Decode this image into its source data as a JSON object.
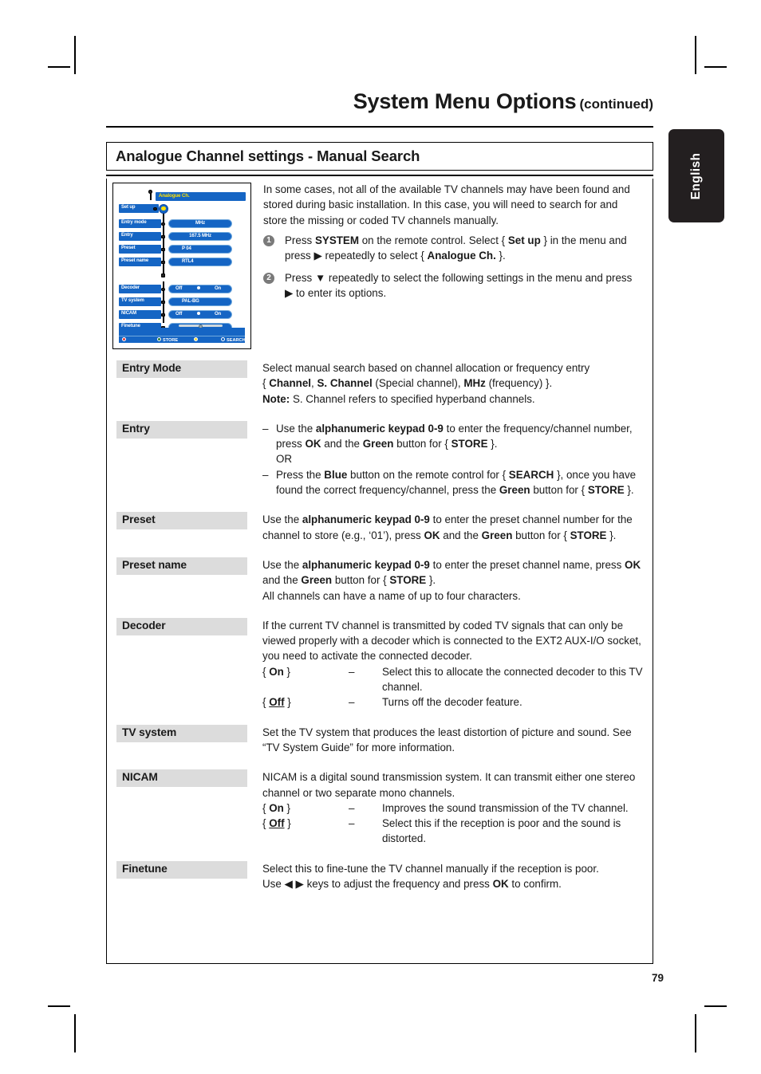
{
  "page": {
    "title": "System Menu Options",
    "title_suffix": "(continued)",
    "section_heading": "Analogue Channel settings - Manual Search",
    "language_tab": "English",
    "page_number": "79"
  },
  "intro": {
    "paragraph": "In some cases, not all of the available TV channels may have been found and stored during basic installation. In this case, you will need to search for and store the missing or coded TV channels manually."
  },
  "steps": [
    {
      "num": "1",
      "parts": [
        {
          "t": "Press ",
          "b": false
        },
        {
          "t": "SYSTEM",
          "b": true
        },
        {
          "t": " on the remote control. Select { ",
          "b": false
        },
        {
          "t": "Set up",
          "b": true
        },
        {
          "t": " } in the menu and press ▶ repeatedly to select { ",
          "b": false
        },
        {
          "t": "Analogue Ch.",
          "b": true
        },
        {
          "t": " }.",
          "b": false
        }
      ]
    },
    {
      "num": "2",
      "parts": [
        {
          "t": "Press ▼ repeatedly to select the following settings in the menu and press ▶ to enter its options.",
          "b": false
        }
      ]
    }
  ],
  "tv_screen": {
    "title": "Analogue Ch.",
    "setup_label": "Set up",
    "group1": [
      {
        "label": "Entry mode",
        "value": "MHz"
      },
      {
        "label": "Entry",
        "value": "167.5 MHz"
      },
      {
        "label": "Preset",
        "value": "P 04"
      },
      {
        "label": "Preset name",
        "value": "RTL4"
      }
    ],
    "group2": [
      {
        "label": "Decoder",
        "value_off": "Off",
        "value_on": "On",
        "selected": "On"
      },
      {
        "label": "TV system",
        "value": "PAL-BG"
      },
      {
        "label": "NICAM",
        "value_off": "Off",
        "value_on": "On",
        "selected": "On"
      },
      {
        "label": "Finetune",
        "value": ""
      }
    ],
    "footer": [
      {
        "dot_color": "#e53935",
        "label": ""
      },
      {
        "dot_color": "#2e7d32",
        "label": "STORE"
      },
      {
        "dot_color": "#fdd835",
        "label": ""
      },
      {
        "dot_color": "#1565c4",
        "label": "SEARCH"
      }
    ],
    "colors": {
      "osd_blue": "#1565c4",
      "osd_title_text": "#ffe000",
      "highlight": "#ffe000"
    }
  },
  "definitions": [
    {
      "term": "Entry Mode",
      "lines": [
        [
          {
            "t": "Select manual search based on channel allocation or frequency entry",
            "b": false
          }
        ],
        [
          {
            "t": "{ ",
            "b": false
          },
          {
            "t": "Channel",
            "b": true
          },
          {
            "t": ", ",
            "b": false
          },
          {
            "t": "S. Channel",
            "b": true
          },
          {
            "t": " (Special channel), ",
            "b": false
          },
          {
            "t": "MHz",
            "b": true
          },
          {
            "t": " (frequency) }.",
            "b": false
          }
        ],
        [
          {
            "t": "Note:",
            "b": true
          },
          {
            "t": " S. Channel refers to specified hyperband channels.",
            "b": false
          }
        ]
      ]
    },
    {
      "term": "Entry",
      "bullets": [
        {
          "mark": "–",
          "parts": [
            {
              "t": "Use the ",
              "b": false
            },
            {
              "t": "alphanumeric keypad 0-9",
              "b": true
            },
            {
              "t": " to enter the frequency/channel number, press ",
              "b": false
            },
            {
              "t": "OK",
              "b": true
            },
            {
              "t": " and the ",
              "b": false
            },
            {
              "t": "Green",
              "b": true
            },
            {
              "t": " button for { ",
              "b": false
            },
            {
              "t": "STORE",
              "b": true
            },
            {
              "t": " }.",
              "b": false
            }
          ]
        },
        {
          "mark": "",
          "parts": [
            {
              "t": "OR",
              "b": false
            }
          ]
        },
        {
          "mark": "–",
          "parts": [
            {
              "t": "Press the ",
              "b": false
            },
            {
              "t": "Blue",
              "b": true
            },
            {
              "t": " button on the remote control for { ",
              "b": false
            },
            {
              "t": "SEARCH",
              "b": true
            },
            {
              "t": " }, once you have found the correct frequency/channel, press the ",
              "b": false
            },
            {
              "t": "Green",
              "b": true
            },
            {
              "t": " button for { ",
              "b": false
            },
            {
              "t": "STORE",
              "b": true
            },
            {
              "t": " }.",
              "b": false
            }
          ]
        }
      ]
    },
    {
      "term": "Preset",
      "lines": [
        [
          {
            "t": "Use the ",
            "b": false
          },
          {
            "t": "alphanumeric keypad 0-9",
            "b": true
          },
          {
            "t": " to enter the preset channel number for the channel to store (e.g., ‘01’), press ",
            "b": false
          },
          {
            "t": "OK",
            "b": true
          },
          {
            "t": " and the ",
            "b": false
          },
          {
            "t": "Green",
            "b": true
          },
          {
            "t": " button for { ",
            "b": false
          },
          {
            "t": "STORE",
            "b": true
          },
          {
            "t": " }.",
            "b": false
          }
        ]
      ]
    },
    {
      "term": "Preset name",
      "lines": [
        [
          {
            "t": "Use the ",
            "b": false
          },
          {
            "t": "alphanumeric keypad 0-9",
            "b": true
          },
          {
            "t": " to enter the preset channel name, press ",
            "b": false
          },
          {
            "t": "OK",
            "b": true
          },
          {
            "t": " and the ",
            "b": false
          },
          {
            "t": "Green",
            "b": true
          },
          {
            "t": " button for { ",
            "b": false
          },
          {
            "t": "STORE",
            "b": true
          },
          {
            "t": " }.",
            "b": false
          }
        ],
        [
          {
            "t": "All channels can have a name of up to four characters.",
            "b": false
          }
        ]
      ]
    },
    {
      "term": "Decoder",
      "lines": [
        [
          {
            "t": "If the current TV channel is transmitted by coded TV signals that can only be viewed properly with a decoder which is connected to the EXT2 AUX-I/O socket, you need to activate the connected decoder.",
            "b": false
          }
        ]
      ],
      "options": [
        {
          "opt": "{ On }",
          "opt_bold": "On",
          "dash": "–",
          "text": "Select this to allocate the connected decoder to this TV channel."
        },
        {
          "opt": "{ Off }",
          "opt_bold": "Off",
          "underline": true,
          "dash": "–",
          "text": "Turns off the decoder feature."
        }
      ]
    },
    {
      "term": "TV system",
      "lines": [
        [
          {
            "t": "Set the TV system that produces the least distortion of picture and sound. See “TV System Guide” for more information.",
            "b": false
          }
        ]
      ]
    },
    {
      "term": "NICAM",
      "lines": [
        [
          {
            "t": "NICAM is a digital sound transmission system. It can transmit either one stereo channel or two separate mono channels.",
            "b": false
          }
        ]
      ],
      "options": [
        {
          "opt": "{ On }",
          "opt_bold": "On",
          "dash": "–",
          "text": "Improves the sound transmission of the TV channel."
        },
        {
          "opt": "{ Off }",
          "opt_bold": "Off",
          "underline": true,
          "dash": "–",
          "text": "Select this if the reception is poor and the sound is distorted."
        }
      ]
    },
    {
      "term": "Finetune",
      "lines": [
        [
          {
            "t": "Select this to fine-tune the TV channel manually if the reception is poor.",
            "b": false
          }
        ],
        [
          {
            "t": "Use ◀ ▶ keys to adjust the frequency and press ",
            "b": false
          },
          {
            "t": "OK",
            "b": true
          },
          {
            "t": " to confirm.",
            "b": false
          }
        ]
      ]
    }
  ]
}
